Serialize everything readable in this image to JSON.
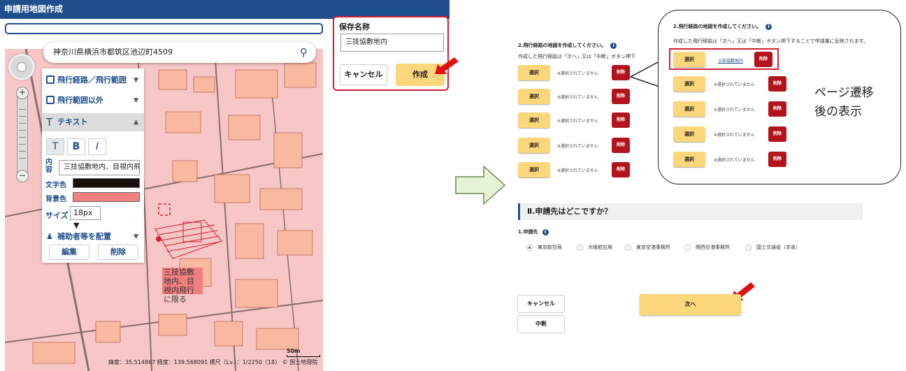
{
  "left": {
    "title": "申請用地図作成",
    "address": "神奈川県横浜市都筑区池辺町4509",
    "tools": {
      "flight_route": "飛行経路／飛行範囲",
      "outside_range": "飛行範囲以外",
      "text": "テキスト",
      "content_label": "内容",
      "content_value": "三技協敷地内、目視内飛",
      "text_color_label": "文字色",
      "bg_color_label": "背景色",
      "size_label": "サイズ",
      "size_value": "18px ▼",
      "assistant": "補助者等を配置",
      "edit": "編集",
      "delete": "削除",
      "bold": "B",
      "italic": "I",
      "normal": "T"
    },
    "map_label": "三技協敷地内、目視内飛行に限る",
    "footer": "緯度：35.514867 経度：139.568091 標尺（Lv.）：1/2250（18） © 国土地理院",
    "scale": "50m",
    "colors": {
      "text_color": "#1a0f0f",
      "bg_color": "#f08080"
    }
  },
  "save": {
    "title": "保存名称",
    "input_value": "三技協敷地内",
    "cancel": "キャンセル",
    "create": "作成"
  },
  "right": {
    "section_heading": "2.飛行経路の地図を作成してください。",
    "section_desc": "作成した飛行経路は「次へ」又は「中断」ボタン押下",
    "select_label": "選択",
    "not_selected": "※選択されていません",
    "delete_label": "削除",
    "section2_title": "Ⅱ.申請先はどこですか？",
    "applicant_label": "1.申請先",
    "radios": [
      "東京航空局",
      "大阪航空局",
      "東京空港事務所",
      "関西空港事務所",
      "国土交通省（本省）"
    ],
    "cancel": "キャンセル",
    "suspend": "中断",
    "next": "次へ"
  },
  "callout": {
    "heading": "2.飛行経路の地図を作成してください。",
    "desc": "作成した飛行経路は「次へ」又は「中断」ボタン押下することで申請書に反映されます。",
    "selected_link": "三技協敷地内",
    "note_line1": "ページ遷移",
    "note_line2": "後の表示"
  }
}
